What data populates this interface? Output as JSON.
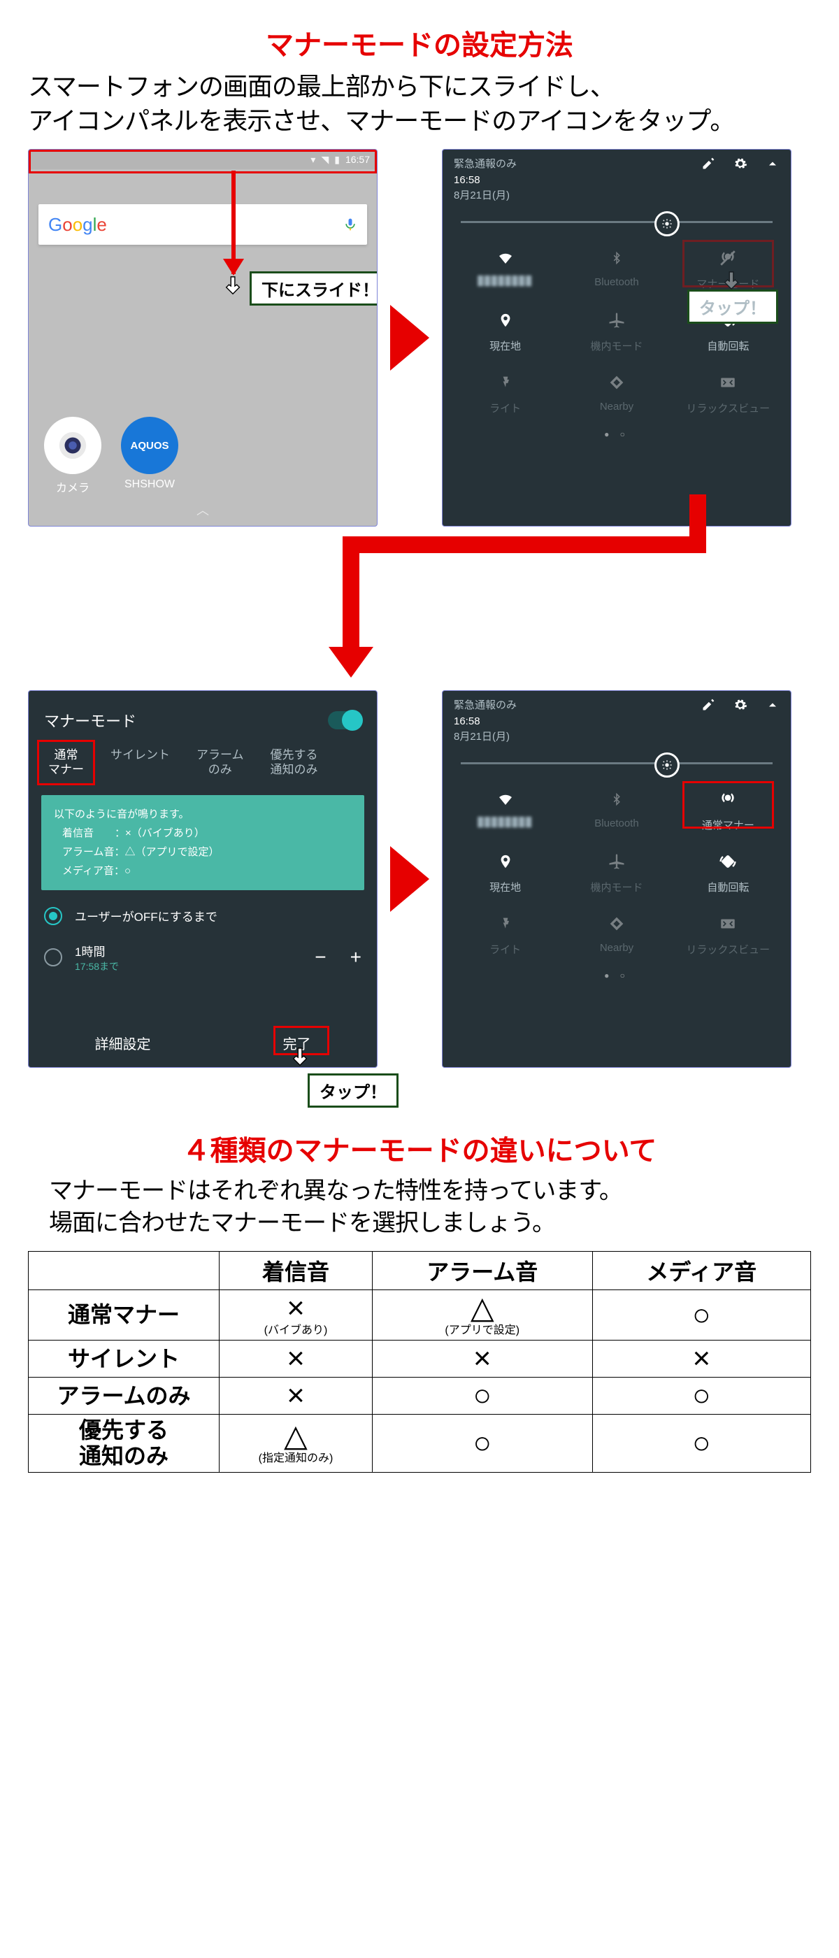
{
  "heading1": "マナーモードの設定方法",
  "intro_line1": "スマートフォンの画面の最上部から下にスライドし、",
  "intro_line2": "アイコンパネルを表示させ、マナーモードのアイコンをタップ。",
  "home_clock": "16:57",
  "callout_slide": "下にスライド！",
  "callout_tap": "タップ！",
  "google": [
    "G",
    "o",
    "o",
    "g",
    "l",
    "e"
  ],
  "apps": {
    "camera": "カメラ",
    "shshow": "SHSHOW",
    "shshow_logo": "AQUOS"
  },
  "qs_common": {
    "emergency": "緊急通報のみ",
    "time": "16:58",
    "date": "8月21日(月)"
  },
  "qs1_tiles": [
    {
      "label": "",
      "kind": "wifi",
      "active": true,
      "blur": true
    },
    {
      "label": "Bluetooth",
      "kind": "bt",
      "dim": true
    },
    {
      "label": "マナーモード",
      "kind": "manner",
      "dim": true,
      "highlight": true
    },
    {
      "label": "現在地",
      "kind": "loc",
      "active": true
    },
    {
      "label": "機内モード",
      "kind": "plane",
      "dim": true
    },
    {
      "label": "自動回転",
      "kind": "rotate",
      "active": true,
      "tap_callout": true
    },
    {
      "label": "ライト",
      "kind": "flash",
      "dim": true
    },
    {
      "label": "Nearby",
      "kind": "nearby",
      "dim": true
    },
    {
      "label": "リラックスビュー",
      "kind": "relax",
      "dim": true
    }
  ],
  "qs2_tiles": [
    {
      "label": "",
      "kind": "wifi",
      "active": true,
      "blur": true
    },
    {
      "label": "Bluetooth",
      "kind": "bt",
      "dim": true
    },
    {
      "label": "通常マナー",
      "kind": "manner-on",
      "active": true,
      "highlight": true
    },
    {
      "label": "現在地",
      "kind": "loc",
      "active": true
    },
    {
      "label": "機内モード",
      "kind": "plane",
      "dim": true
    },
    {
      "label": "自動回転",
      "kind": "rotate",
      "active": true
    },
    {
      "label": "ライト",
      "kind": "flash",
      "dim": true
    },
    {
      "label": "Nearby",
      "kind": "nearby",
      "dim": true
    },
    {
      "label": "リラックスビュー",
      "kind": "relax",
      "dim": true
    }
  ],
  "mm": {
    "title": "マナーモード",
    "tabs": [
      "通常\nマナー",
      "サイレント",
      "アラーム\nのみ",
      "優先する\n通知のみ"
    ],
    "info_title": "以下のように音が鳴ります。",
    "info_lines": [
      "着信音　　：×（バイブあり）",
      "アラーム音：△（アプリで設定）",
      "メディア音：○"
    ],
    "radio1": "ユーザーがOFFにするまで",
    "radio2_top": "1時間",
    "radio2_sub": "17:58まで",
    "detail": "詳細設定",
    "done": "完了"
  },
  "heading2": "４種類のマナーモードの違いについて",
  "desc_line1": "マナーモードはそれぞれ異なった特性を持っています。",
  "desc_line2": "場面に合わせたマナーモードを選択しましょう。",
  "table": {
    "cols": [
      "",
      "着信音",
      "アラーム音",
      "メディア音"
    ],
    "rows": [
      {
        "head": "通常マナー",
        "cells": [
          {
            "sym": "×",
            "note": "(バイブあり)"
          },
          {
            "sym": "△",
            "note": "(アプリで設定)"
          },
          {
            "sym": "○"
          }
        ]
      },
      {
        "head": "サイレント",
        "cells": [
          {
            "sym": "×"
          },
          {
            "sym": "×"
          },
          {
            "sym": "×"
          }
        ]
      },
      {
        "head": "アラームのみ",
        "cells": [
          {
            "sym": "×"
          },
          {
            "sym": "○"
          },
          {
            "sym": "○"
          }
        ]
      },
      {
        "head": "優先する\n通知のみ",
        "cells": [
          {
            "sym": "△",
            "note": "(指定通知のみ)"
          },
          {
            "sym": "○"
          },
          {
            "sym": "○"
          }
        ]
      }
    ]
  }
}
